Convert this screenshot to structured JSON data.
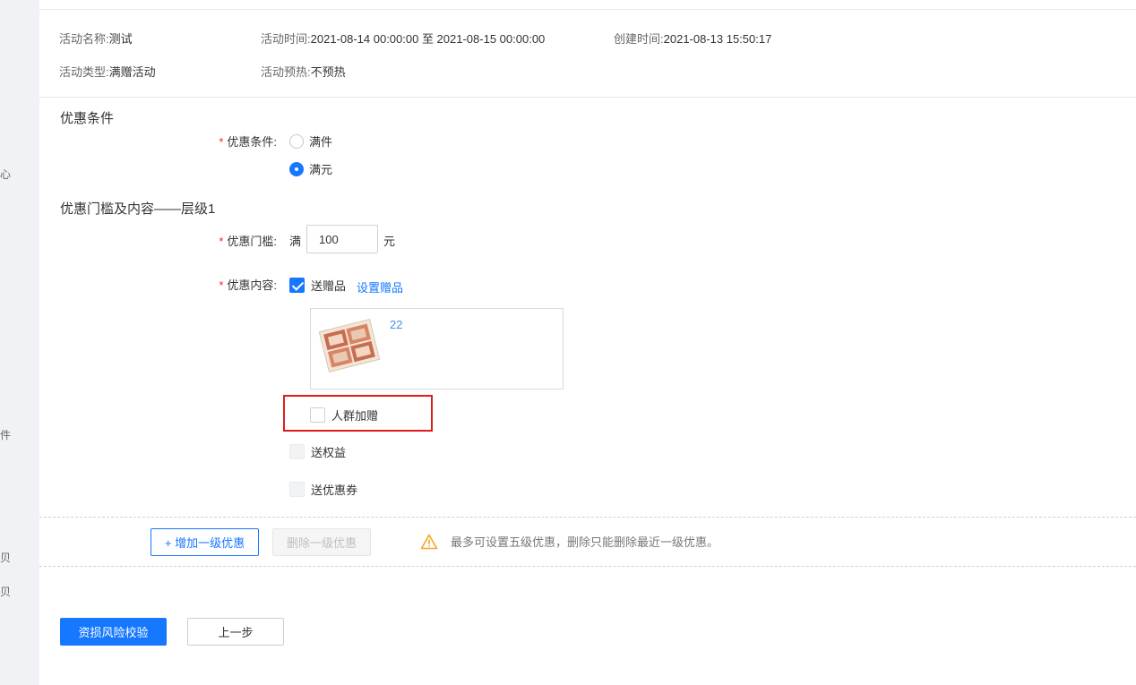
{
  "info": {
    "name_label": "活动名称:",
    "name_value": "测试",
    "time_label": "活动时间:",
    "time_value": "2021-08-14 00:00:00 至 2021-08-15 00:00:00",
    "created_label": "创建时间:",
    "created_value": "2021-08-13 15:50:17",
    "type_label": "活动类型:",
    "type_value": "满赠活动",
    "preheat_label": "活动预热:",
    "preheat_value": "不预热"
  },
  "condition_section": {
    "title": "优惠条件",
    "label": "优惠条件:",
    "options": [
      {
        "label": "满件",
        "checked": false
      },
      {
        "label": "满元",
        "checked": true
      }
    ]
  },
  "tier_section": {
    "title": "优惠门槛及内容——层级1",
    "threshold_label": "优惠门槛:",
    "threshold_prefix": "满",
    "threshold_value": "100",
    "threshold_unit": "元",
    "content_label": "优惠内容:",
    "send_gift_label": "送赠品",
    "set_gift_link": "设置赠品",
    "gift_name": "22",
    "crowd_gift_label": "人群加赠",
    "send_rights_label": "送权益",
    "send_coupon_label": "送优惠券"
  },
  "tier_actions": {
    "add_label": "+ 增加一级优惠",
    "delete_label": "删除一级优惠",
    "warning": "最多可设置五级优惠，删除只能删除最近一级优惠。"
  },
  "footer": {
    "risk_check_label": "资损风险校验",
    "prev_label": "上一步"
  },
  "left_rail": {
    "stubs": [
      "心",
      "件",
      "贝",
      "贝"
    ]
  },
  "colors": {
    "primary": "#1677ff",
    "required": "#f5222d",
    "highlight": "#e01b1b",
    "warning": "#f5a623"
  }
}
